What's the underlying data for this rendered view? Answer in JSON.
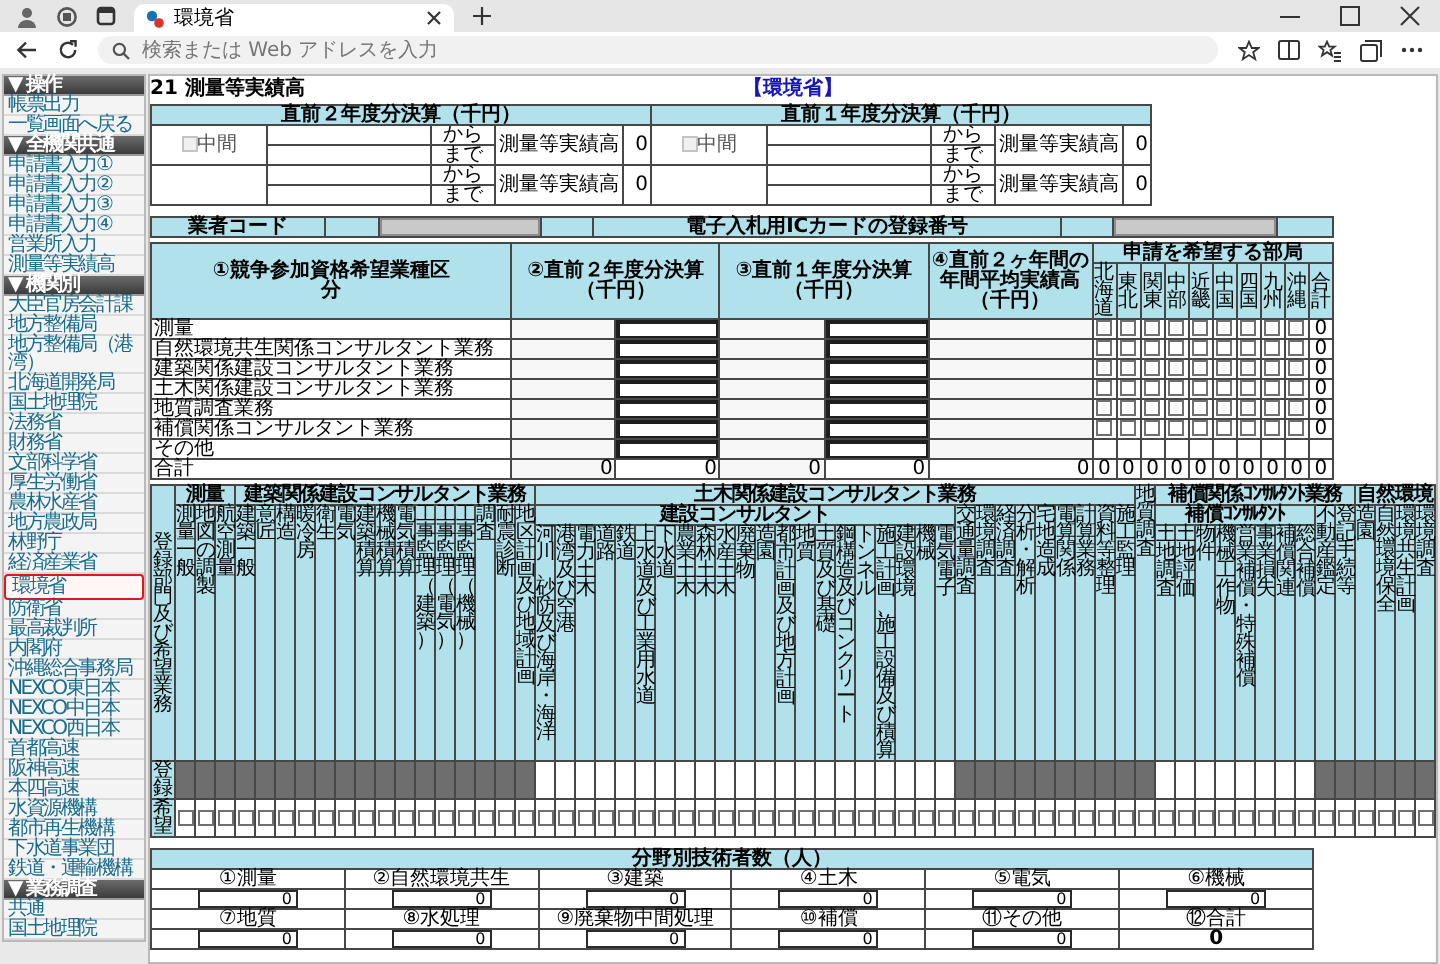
{
  "browser": {
    "tab_title": "環境省",
    "address_placeholder": "検索または Web アドレスを入力"
  },
  "sidebar": {
    "sections": [
      {
        "header": "▼ 操作",
        "items": [
          {
            "label": "帳票出力",
            "selected": false
          },
          {
            "label": "一覧画面へ戻る",
            "selected": false
          }
        ]
      },
      {
        "header": "▼ 全機関共通",
        "items": [
          {
            "label": "申請書入力①",
            "selected": false
          },
          {
            "label": "申請書入力②",
            "selected": false
          },
          {
            "label": "申請書入力③",
            "selected": false
          },
          {
            "label": "申請書入力④",
            "selected": false
          },
          {
            "label": "営業所入力",
            "selected": false
          },
          {
            "label": "測量等実績高",
            "selected": false
          }
        ]
      },
      {
        "header": "▼ 機関別",
        "items": [
          {
            "label": "大臣官房会計課",
            "selected": false
          },
          {
            "label": "地方整備局",
            "selected": false
          },
          {
            "label": "地方整備局（港湾）",
            "selected": false
          },
          {
            "label": "北海道開発局",
            "selected": false
          },
          {
            "label": "国土地理院",
            "selected": false
          },
          {
            "label": "法務省",
            "selected": false
          },
          {
            "label": "財務省",
            "selected": false
          },
          {
            "label": "文部科学省",
            "selected": false
          },
          {
            "label": "厚生労働省",
            "selected": false
          },
          {
            "label": "農林水産省",
            "selected": false
          },
          {
            "label": "地方農政局",
            "selected": false
          },
          {
            "label": "林野庁",
            "selected": false
          },
          {
            "label": "経済産業省",
            "selected": false
          },
          {
            "label": "環境省",
            "selected": true
          },
          {
            "label": "防衛省",
            "selected": false
          },
          {
            "label": "最高裁判所",
            "selected": false
          },
          {
            "label": "内閣府",
            "selected": false
          },
          {
            "label": "沖縄総合事務局",
            "selected": false
          },
          {
            "label": "NEXCO東日本",
            "selected": false
          },
          {
            "label": "NEXCO中日本",
            "selected": false
          },
          {
            "label": "NEXCO西日本",
            "selected": false
          },
          {
            "label": "首都高速",
            "selected": false
          },
          {
            "label": "阪神高速",
            "selected": false
          },
          {
            "label": "本四高速",
            "selected": false
          },
          {
            "label": "水資源機構",
            "selected": false
          },
          {
            "label": "都市再生機構",
            "selected": false
          },
          {
            "label": "下水道事業団",
            "selected": false
          },
          {
            "label": "鉄道・運輸機構",
            "selected": false
          }
        ]
      },
      {
        "header": "▼ 業務調査",
        "items": [
          {
            "label": "共通",
            "selected": false
          },
          {
            "label": "国土地理院",
            "selected": false
          }
        ]
      }
    ]
  },
  "page": {
    "agency": "【環境省】",
    "section": "21 測量等実績高"
  },
  "results": {
    "periods": [
      {
        "header": "直前２年度分決算（千円）",
        "blocks": [
          {
            "interim": {
              "label": "中間",
              "checked": false,
              "disabled": true
            },
            "from": "から",
            "to": "まで",
            "result_label": "測量等実績高",
            "value": "0"
          },
          {
            "from": "から",
            "to": "まで",
            "result_label": "測量等実績高",
            "value": "0"
          }
        ]
      },
      {
        "header": "直前１年度分決算（千円）",
        "blocks": [
          {
            "interim": {
              "label": "中間",
              "checked": false,
              "disabled": true
            },
            "from": "から",
            "to": "まで",
            "result_label": "測量等実績高",
            "value": "0"
          },
          {
            "from": "から",
            "to": "まで",
            "result_label": "測量等実績高",
            "value": "0"
          }
        ]
      }
    ]
  },
  "registration": {
    "vendor_code_label": "業者コード",
    "ic_card_label": "電子入札用ICカードの登録番号"
  },
  "applications": {
    "headers": [
      "①競争参加資格希望業種区分",
      "②直前２年度分決算（千円）",
      "③直前１年度分決算（千円）",
      "④直前２ヶ年間の年間平均実績高（千円）"
    ],
    "dept_header": "申請を希望する部局",
    "depts": [
      "北海道",
      "東北",
      "関東",
      "中部",
      "近畿",
      "中国",
      "四国",
      "九州",
      "沖縄",
      "合計"
    ],
    "rows": [
      {
        "kind": "business",
        "label": "測量",
        "checked": [
          false,
          false,
          false,
          false,
          false,
          false,
          false,
          false,
          false
        ],
        "total": "0"
      },
      {
        "kind": "business",
        "label": "自然環境共生関係コンサルタント業務",
        "checked": [
          false,
          false,
          false,
          false,
          false,
          false,
          false,
          false,
          false
        ],
        "total": "0"
      },
      {
        "kind": "business",
        "label": "建築関係建設コンサルタント業務",
        "checked": [
          false,
          false,
          false,
          false,
          false,
          false,
          false,
          false,
          false
        ],
        "total": "0"
      },
      {
        "kind": "business",
        "label": "土木関係建設コンサルタント業務",
        "checked": [
          false,
          false,
          false,
          false,
          false,
          false,
          false,
          false,
          false
        ],
        "total": "0"
      },
      {
        "kind": "business",
        "label": "地質調査業務",
        "checked": [
          false,
          false,
          false,
          false,
          false,
          false,
          false,
          false,
          false
        ],
        "total": "0"
      },
      {
        "kind": "business",
        "label": "補償関係コンサルタント業務",
        "checked": [
          false,
          false,
          false,
          false,
          false,
          false,
          false,
          false,
          false
        ],
        "total": "0"
      },
      {
        "kind": "business",
        "label": "その他"
      },
      {
        "kind": "total",
        "label": "合計",
        "values": [
          "0",
          "0",
          "0",
          "0",
          "0"
        ],
        "dept_totals": [
          "0",
          "0",
          "0",
          "0",
          "0",
          "0",
          "0",
          "0",
          "0"
        ],
        "total": "0"
      }
    ]
  },
  "jobs": {
    "side_label": "登録部門及び希望業務",
    "row_labels": [
      "登録",
      "希望"
    ],
    "groups": [
      {
        "kind": "group",
        "label": "測量",
        "items": [
          {
            "kind": "column",
            "label": "測量一般",
            "disabled": true,
            "checked": false
          },
          {
            "kind": "column",
            "label": "地図の調製",
            "disabled": true,
            "checked": false
          },
          {
            "kind": "column",
            "label": "航空測量",
            "disabled": true,
            "checked": false
          }
        ]
      },
      {
        "kind": "group",
        "label": "建築関係建設コンサルタント業務",
        "items": [
          {
            "kind": "column",
            "label": "建築一般",
            "disabled": true,
            "checked": false
          },
          {
            "kind": "column",
            "label": "意匠",
            "disabled": true,
            "checked": false
          },
          {
            "kind": "column",
            "label": "構造",
            "disabled": true,
            "checked": false
          },
          {
            "kind": "column",
            "label": "暖冷房",
            "disabled": true,
            "checked": false
          },
          {
            "kind": "column",
            "label": "衛生",
            "disabled": true,
            "checked": false
          },
          {
            "kind": "column",
            "label": "電気",
            "disabled": true,
            "checked": false
          },
          {
            "kind": "column",
            "label": "建築積算",
            "disabled": true,
            "checked": false
          },
          {
            "kind": "column",
            "label": "機械積算",
            "disabled": true,
            "checked": false
          },
          {
            "kind": "column",
            "label": "電気積算",
            "disabled": true,
            "checked": false
          },
          {
            "kind": "column",
            "label": "工事監理（建築）",
            "disabled": true,
            "checked": false
          },
          {
            "kind": "column",
            "label": "工事監理（電気）",
            "disabled": true,
            "checked": false
          },
          {
            "kind": "column",
            "label": "工事監理（機械）",
            "disabled": true,
            "checked": false
          },
          {
            "kind": "column",
            "label": "調査",
            "disabled": true,
            "checked": false
          },
          {
            "kind": "column",
            "label": "耐震診断",
            "disabled": true,
            "checked": false
          },
          {
            "kind": "column",
            "label": "地区計画及び地域計画",
            "disabled": true,
            "checked": false
          }
        ]
      },
      {
        "kind": "group",
        "label": "土木関係建設コンサルタント業務",
        "items": [
          {
            "kind": "subgroup",
            "label": "建設コンサルタント",
            "items": [
              {
                "kind": "column",
                "label": "河川、砂防及び海岸・海洋",
                "disabled": false,
                "checked": false
              },
              {
                "kind": "column",
                "label": "港湾及び空港",
                "disabled": false,
                "checked": false
              },
              {
                "kind": "column",
                "label": "電力土木",
                "disabled": false,
                "checked": false
              },
              {
                "kind": "column",
                "label": "道路",
                "disabled": false,
                "checked": false
              },
              {
                "kind": "column",
                "label": "鉄道",
                "disabled": false,
                "checked": false
              },
              {
                "kind": "column",
                "label": "上水道及び工業用水道",
                "disabled": false,
                "checked": false
              },
              {
                "kind": "column",
                "label": "下水道",
                "disabled": false,
                "checked": false
              },
              {
                "kind": "column",
                "label": "農業土木",
                "disabled": false,
                "checked": false
              },
              {
                "kind": "column",
                "label": "森林土木",
                "disabled": false,
                "checked": false
              },
              {
                "kind": "column",
                "label": "水産土木",
                "disabled": false,
                "checked": false
              },
              {
                "kind": "column",
                "label": "廃棄物",
                "disabled": false,
                "checked": false
              },
              {
                "kind": "column",
                "label": "造園",
                "disabled": false,
                "checked": false
              },
              {
                "kind": "column",
                "label": "都市計画及び地方計画",
                "disabled": false,
                "checked": false
              },
              {
                "kind": "column",
                "label": "地質",
                "disabled": false,
                "checked": false
              },
              {
                "kind": "column",
                "label": "土質及び基礎",
                "disabled": false,
                "checked": false
              },
              {
                "kind": "column",
                "label": "鋼構造及びコンクリート",
                "disabled": false,
                "checked": false
              },
              {
                "kind": "column",
                "label": "トンネル",
                "disabled": false,
                "checked": false
              },
              {
                "kind": "column",
                "label": "施工計画、施工設備及び積算",
                "disabled": false,
                "checked": false
              },
              {
                "kind": "column",
                "label": "建設環境",
                "disabled": false,
                "checked": false
              },
              {
                "kind": "column",
                "label": "機械",
                "disabled": false,
                "checked": false
              },
              {
                "kind": "column",
                "label": "電気電子",
                "disabled": false,
                "checked": false
              }
            ]
          },
          {
            "kind": "column",
            "label": "交通量調査",
            "disabled": true,
            "checked": false
          },
          {
            "kind": "column",
            "label": "環境調査",
            "disabled": true,
            "checked": false
          },
          {
            "kind": "column",
            "label": "経済調査",
            "disabled": true,
            "checked": false
          },
          {
            "kind": "column",
            "label": "分析・解析",
            "disabled": true,
            "checked": false
          },
          {
            "kind": "column",
            "label": "宅地造成",
            "disabled": true,
            "checked": false
          },
          {
            "kind": "column",
            "label": "電算関係",
            "disabled": true,
            "checked": false
          },
          {
            "kind": "column",
            "label": "計算業務",
            "disabled": true,
            "checked": false
          },
          {
            "kind": "column",
            "label": "資料等整理",
            "disabled": true,
            "checked": false
          },
          {
            "kind": "column",
            "label": "施工監理",
            "disabled": true,
            "checked": false
          }
        ]
      },
      {
        "kind": "column",
        "label": "地質調査",
        "disabled": true,
        "checked": false
      },
      {
        "kind": "group",
        "label": "補償関係ｺﾝｻﾙﾀﾝﾄ業務",
        "items": [
          {
            "kind": "subgroup",
            "label": "補償ｺﾝｻﾙﾀﾝﾄ",
            "items": [
              {
                "kind": "column",
                "label": "土地調査",
                "disabled": false,
                "checked": false
              },
              {
                "kind": "column",
                "label": "土地評価",
                "disabled": false,
                "checked": false
              },
              {
                "kind": "column",
                "label": "物件",
                "disabled": false,
                "checked": false
              },
              {
                "kind": "column",
                "label": "機械工作物",
                "disabled": false,
                "checked": false
              },
              {
                "kind": "column",
                "label": "営業補償・特殊補償",
                "disabled": false,
                "checked": false
              },
              {
                "kind": "column",
                "label": "事業損失",
                "disabled": false,
                "checked": false
              },
              {
                "kind": "column",
                "label": "補償関連",
                "disabled": false,
                "checked": false
              },
              {
                "kind": "column",
                "label": "総合補償",
                "disabled": false,
                "checked": false
              }
            ]
          },
          {
            "kind": "column",
            "label": "不動産鑑定",
            "disabled": true,
            "checked": false
          },
          {
            "kind": "column",
            "label": "登記手続等",
            "disabled": true,
            "checked": false
          }
        ]
      },
      {
        "kind": "group",
        "label": "自然環境",
        "items": [
          {
            "kind": "column",
            "label": "造園",
            "disabled": true,
            "checked": false
          },
          {
            "kind": "column",
            "label": "自然環境保全",
            "disabled": true,
            "checked": false
          },
          {
            "kind": "column",
            "label": "環境共生計画",
            "disabled": true,
            "checked": false
          },
          {
            "kind": "column",
            "label": "環境調査",
            "disabled": true,
            "checked": false
          }
        ]
      }
    ]
  },
  "engineers": {
    "title": "分野別技術者数（人）",
    "fields": [
      {
        "kind": "input",
        "label": "①測量",
        "value": "0"
      },
      {
        "kind": "input",
        "label": "②自然環境共生",
        "value": "0"
      },
      {
        "kind": "input",
        "label": "③建築",
        "value": "0"
      },
      {
        "kind": "input",
        "label": "④土木",
        "value": "0"
      },
      {
        "kind": "input",
        "label": "⑤電気",
        "value": "0"
      },
      {
        "kind": "input",
        "label": "⑥機械",
        "value": "0"
      },
      {
        "kind": "input",
        "label": "⑦地質",
        "value": "0"
      },
      {
        "kind": "input",
        "label": "⑧水処理",
        "value": "0"
      },
      {
        "kind": "input",
        "label": "⑨廃棄物中間処理",
        "value": "0"
      },
      {
        "kind": "input",
        "label": "⑩補償",
        "value": "0"
      },
      {
        "kind": "input",
        "label": "⑪その他",
        "value": "0"
      },
      {
        "kind": "total",
        "label": "⑫合計",
        "value": "0"
      }
    ]
  }
}
